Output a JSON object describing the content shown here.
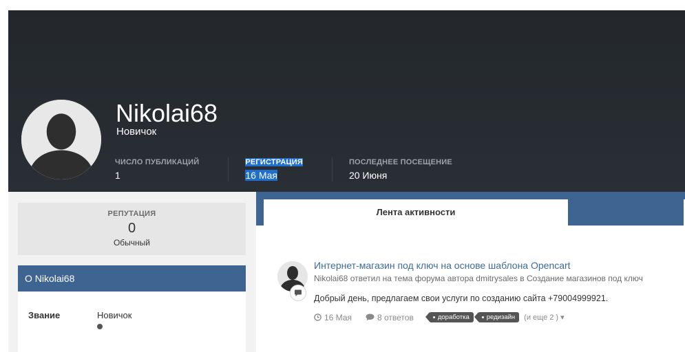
{
  "profile": {
    "username": "Nikolai68",
    "rank": "Новичок",
    "stats": [
      {
        "label": "Число публикаций",
        "value": "1"
      },
      {
        "label": "Регистрация",
        "value": "16 Мая"
      },
      {
        "label": "Последнее посещение",
        "value": "20 Июня"
      }
    ]
  },
  "sidebar": {
    "reputation_label": "РЕПУТАЦИЯ",
    "reputation_value": "0",
    "reputation_type": "Обычный",
    "about_title": "О Nikolai68",
    "about_key": "Звание",
    "about_value": "Новичок"
  },
  "tabs": {
    "active_label": "Лента активности"
  },
  "activity": {
    "title": "Интернет-магазин под ключ на основе шаблона Opencart",
    "meta": "Nikolai68 ответил на тема форума автора dmitrysales в Создание магазинов под ключ",
    "body": "Добрый день, предлагаем свои услуги по созданию сайта +79004999921.",
    "date": "16 Мая",
    "replies": "8 ответов",
    "tags": [
      "доработка",
      "редизайн"
    ],
    "more": "(и еще 2 )"
  },
  "colors": {
    "header_bg": "#262b31",
    "accent_blue": "#3e6591",
    "highlight": "#1f6fd1",
    "link": "#3d6b9c"
  }
}
